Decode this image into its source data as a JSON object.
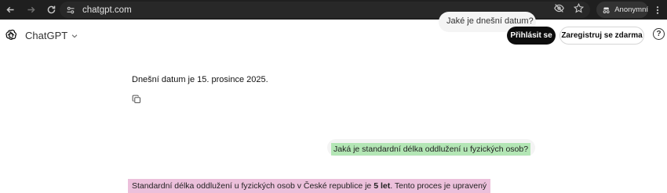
{
  "browser": {
    "url": "chatgpt.com",
    "profile_label": "Anonymní",
    "icons": [
      "back-icon",
      "forward-icon",
      "reload-icon",
      "site-info-icon",
      "eye-off-icon",
      "star-icon",
      "incognito-icon",
      "more-vert-icon"
    ]
  },
  "header": {
    "model_name": "ChatGPT",
    "previous_message_preview": "Jaké je dnešní datum?",
    "login_label": "Přihlásit se",
    "signup_label": "Zaregistruj se zdarma",
    "help_label": "?"
  },
  "conversation": {
    "assistant_reply_1": "Dnešní datum je 15. prosince 2025.",
    "user_message": "Jaká je standardní délka oddlužení u fyzických osob?",
    "assistant_reply_2_before": "Standardní délka oddlužení u fyzických osob v České republice je ",
    "assistant_reply_2_bold": "5 let",
    "assistant_reply_2_after": ". Tento proces je upravený"
  },
  "colors": {
    "browser_bar": "#1f1f1f",
    "user_highlight": "#b3e6b5",
    "answer_highlight": "#ecc0db",
    "login_bg": "#0d0d0d"
  }
}
